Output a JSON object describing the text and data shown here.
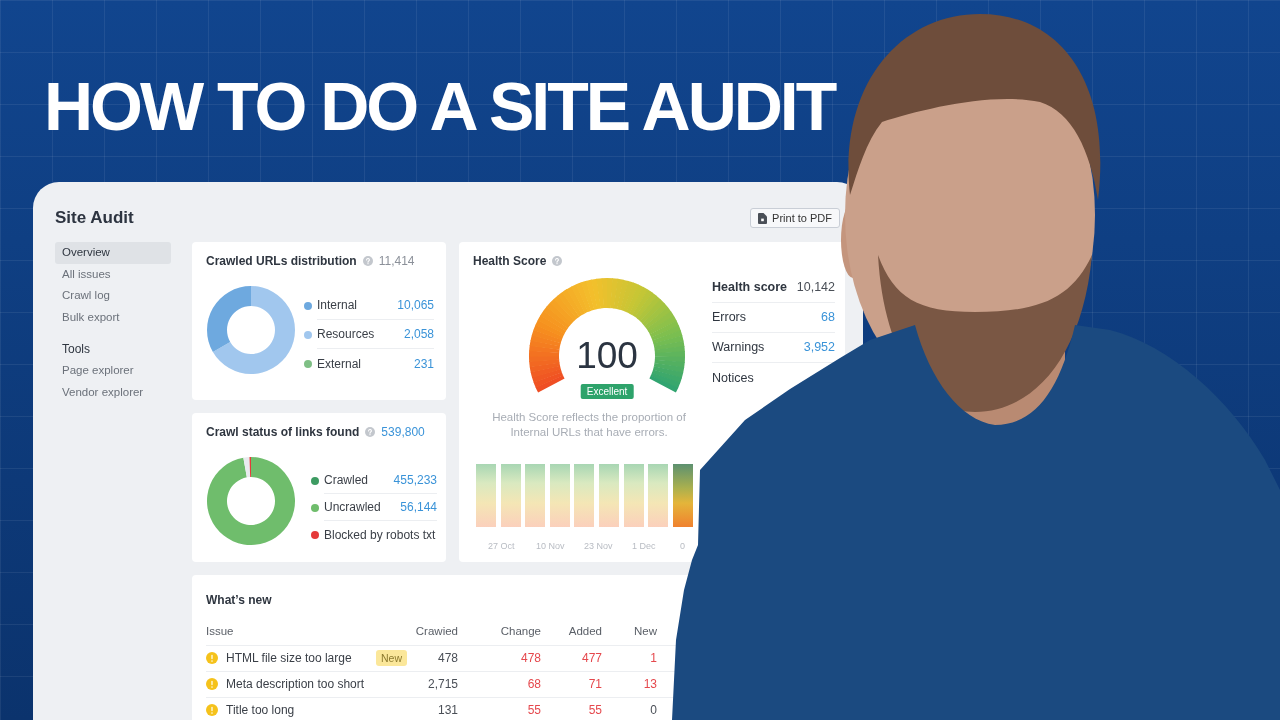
{
  "headline": "HOW TO DO A SITE AUDIT",
  "app": {
    "title": "Site Audit",
    "print_button": "Print to PDF",
    "sidebar": {
      "sections": [
        {
          "items": [
            {
              "label": "Overview",
              "selected": true
            },
            {
              "label": "All issues",
              "selected": false
            },
            {
              "label": "Crawl log",
              "selected": false
            },
            {
              "label": "Bulk export",
              "selected": false
            }
          ]
        },
        {
          "heading": "Tools",
          "items": [
            {
              "label": "Page explorer",
              "selected": false
            },
            {
              "label": "Vendor explorer",
              "selected": false
            }
          ]
        }
      ]
    }
  },
  "crawled_urls": {
    "title": "Crawled URLs distribution",
    "total": "11,414",
    "total_link": false,
    "legend": [
      {
        "label": "Internal",
        "value": "10,065",
        "color": "#6ea9df"
      },
      {
        "label": "Resources",
        "value": "2,058",
        "color": "#a1c7ee"
      },
      {
        "label": "External",
        "value": "231",
        "color": "#7fbf85"
      }
    ]
  },
  "crawl_status": {
    "title": "Crawl status of links found",
    "total": "539,800",
    "total_link": true,
    "legend": [
      {
        "label": "Crawled",
        "value": "455,233",
        "color": "#3d9b62"
      },
      {
        "label": "Uncrawled",
        "value": "56,144",
        "color": "#6fbd6c"
      },
      {
        "label": "Blocked by robots txt",
        "color": "#e53a3a"
      }
    ]
  },
  "health_score": {
    "title": "Health Score",
    "score": "100",
    "rating": "Excellent",
    "description": "Health Score reflects the proportion of Internal URLs that have errors.",
    "stats": [
      {
        "label": "Health score",
        "value": "10,142",
        "kind": "summary"
      },
      {
        "label": "Errors",
        "value": "68",
        "kind": "count"
      },
      {
        "label": "Warnings",
        "value": "3,952",
        "kind": "count"
      },
      {
        "label": "Notices",
        "kind": "count"
      }
    ],
    "history_bars": [
      {
        "selected": false
      },
      {
        "selected": false
      },
      {
        "selected": false
      },
      {
        "selected": false
      },
      {
        "selected": false
      },
      {
        "selected": false
      },
      {
        "selected": false
      },
      {
        "selected": false
      },
      {
        "selected": true
      }
    ],
    "history_labels": [
      "27 Oct",
      "10 Nov",
      "23 Nov",
      "1 Dec",
      "0"
    ]
  },
  "whats_new": {
    "title": "What’s new",
    "columns": [
      "Issue",
      "Crawied",
      "Change",
      "Added",
      "New"
    ],
    "rows": [
      {
        "cells": [
          {
            "text": "HTML file size too large",
            "badge": "New"
          },
          {
            "text": "478",
            "alert": false
          },
          {
            "text": "478",
            "alert": true
          },
          {
            "text": "477",
            "alert": true
          },
          {
            "text": "1",
            "alert": true
          }
        ]
      },
      {
        "cells": [
          {
            "text": "Meta description too short"
          },
          {
            "text": "2,715",
            "alert": false
          },
          {
            "text": "68",
            "alert": true
          },
          {
            "text": "71",
            "alert": true
          },
          {
            "text": "13",
            "alert": true
          }
        ]
      },
      {
        "cells": [
          {
            "text": "Title too long"
          },
          {
            "text": "131",
            "alert": false
          },
          {
            "text": "55",
            "alert": true
          },
          {
            "text": "55",
            "alert": true
          },
          {
            "text": "0",
            "alert": false
          }
        ]
      }
    ]
  }
}
